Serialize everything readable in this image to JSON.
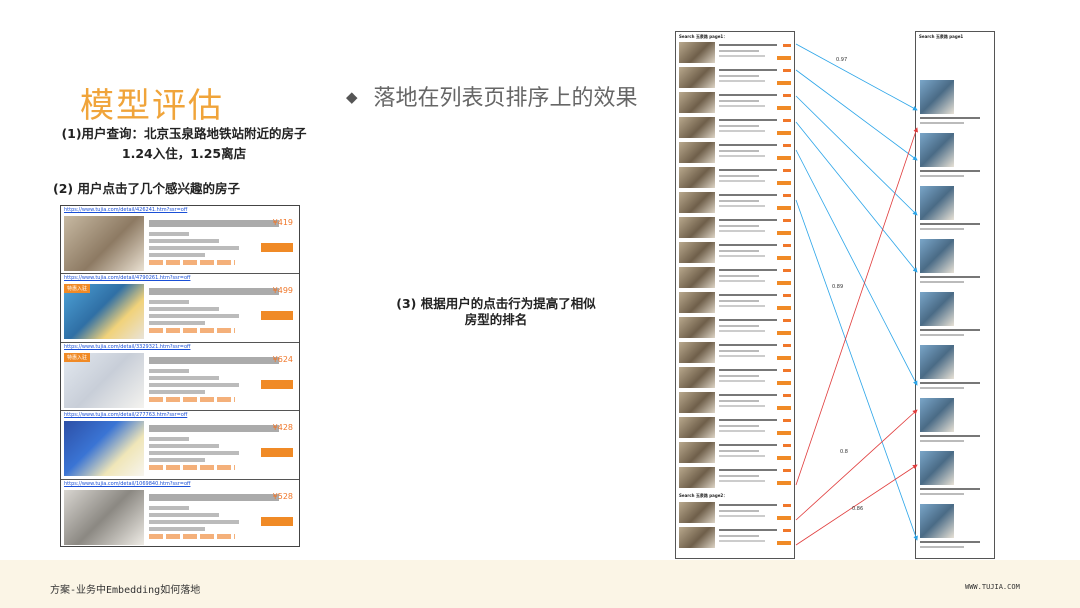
{
  "title": "模型评估",
  "subtitle": "落地在列表页排序上的效果",
  "query": {
    "line1": "(1)用户查询：北京玉泉路地铁站附近的房子",
    "line2": "1.24入住，1.25离店"
  },
  "clicked_heading": "(2) 用户点击了几个感兴趣的房子",
  "result_heading": {
    "line1": "(3) 根据用户的点击行为提高了相似",
    "line2": "房型的排名"
  },
  "clicked_cards": [
    {
      "url": "https://www.tujia.com/detail/426241.htm?ssr=off",
      "price": "¥419",
      "badge": ""
    },
    {
      "url": "https://www.tujia.com/detail/4790261.htm?ssr=off",
      "price": "¥499",
      "badge": "特惠入驻"
    },
    {
      "url": "https://www.tujia.com/detail/3329321.htm?ssr=off",
      "price": "¥624",
      "badge": "特惠入驻"
    },
    {
      "url": "https://www.tujia.com/detail/277763.htm?ssr=off",
      "price": "¥428",
      "badge": ""
    },
    {
      "url": "https://www.tujia.com/detail/1069840.htm?ssr=off",
      "price": "¥528",
      "badge": ""
    }
  ],
  "list_before": {
    "header": "Search 玉泉路 page1：",
    "header2": "Search 玉泉路 page2："
  },
  "list_after": {
    "header": "Search 玉泉路 page1"
  },
  "similarity_scores": [
    "0.97",
    "0.89",
    "0.8",
    "0.86"
  ],
  "footer": {
    "left": "方案-业务中Embedding如何落地",
    "right": "WWW.TUJIA.COM"
  },
  "colors": {
    "title": "#f0a43a",
    "blue_arrow": "#2aa4e8",
    "red_arrow": "#e03b3b",
    "footer_bg": "#fbf5e6"
  }
}
